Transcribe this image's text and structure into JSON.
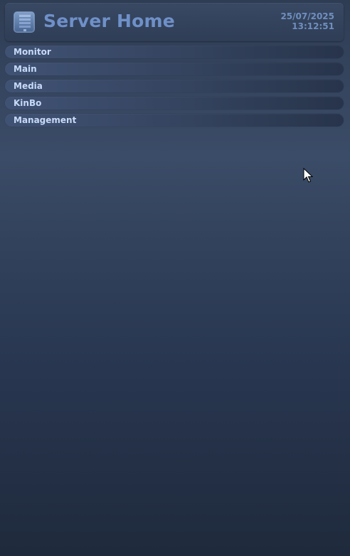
{
  "header": {
    "icon": "server-icon",
    "title": "Server Home",
    "date": "25/07/2025",
    "time": "13:12:51"
  },
  "nav": {
    "items": [
      {
        "label": "Monitor"
      },
      {
        "label": "Main"
      },
      {
        "label": "Media"
      },
      {
        "label": "KinBo"
      },
      {
        "label": "Management"
      }
    ]
  },
  "cursor": {
    "icon": "mouse-pointer-icon"
  },
  "colors": {
    "background_top": "#2f3d54",
    "background_bottom": "#1f2a3c",
    "title": "#6f90c8",
    "nav_text": "#c8daf8"
  }
}
